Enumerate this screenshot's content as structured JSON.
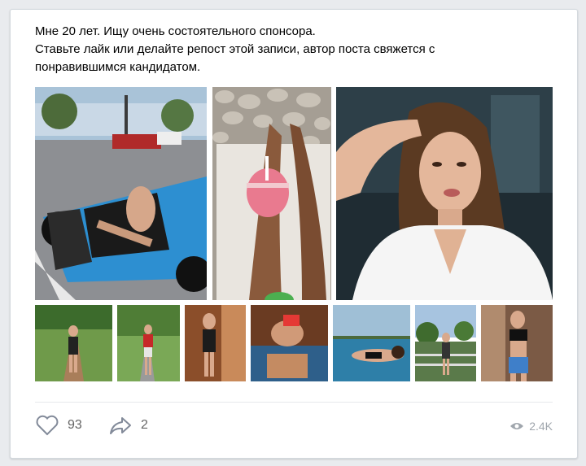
{
  "post": {
    "text_lines": [
      "Мне 20 лет. Ищу очень состоятельного спонсора.",
      "Ставьте лайк или делайте репост этой записи, автор поста свяжется с",
      "понравившимся кандидатом."
    ]
  },
  "photos": {
    "large": [
      {
        "icon": "car-photo"
      },
      {
        "icon": "legs-smoothie-photo"
      },
      {
        "icon": "portrait-photo"
      }
    ],
    "small_count": 7
  },
  "actions": {
    "likes": "93",
    "shares": "2",
    "views": "2.4K"
  },
  "colors": {
    "icon_gray": "#828a99",
    "accent_blue": "#2a5885"
  }
}
